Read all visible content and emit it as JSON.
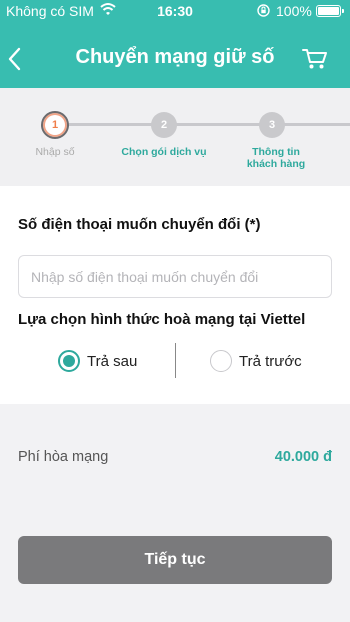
{
  "status_bar": {
    "carrier": "Không có SIM",
    "time": "16:30",
    "battery_percent": "100%"
  },
  "header": {
    "title": "Chuyển mạng giữ số"
  },
  "stepper": {
    "steps": [
      {
        "number": "1",
        "label": "Nhập số",
        "state": "active"
      },
      {
        "number": "2",
        "label": "Chọn gói dịch vụ",
        "state": "pending"
      },
      {
        "number": "3",
        "label": "Thông tin khách hàng",
        "state": "pending"
      }
    ]
  },
  "form": {
    "phone_label": "Số điện thoại muốn chuyển đổi (*)",
    "phone_placeholder": "Nhập số điện thoại muốn chuyển đổi",
    "phone_value": "",
    "subscription_label": "Lựa chọn hình thức hoà mạng tại Viettel",
    "options": [
      {
        "label": "Trả sau",
        "selected": true
      },
      {
        "label": "Trả trước",
        "selected": false
      }
    ]
  },
  "fee": {
    "label": "Phí hòa mạng",
    "value": "40.000 đ"
  },
  "continue_button": {
    "label": "Tiếp tục"
  },
  "colors": {
    "header_bg": "#38bdb0",
    "accent": "#2ea99d",
    "button_disabled": "#7a7a7c",
    "active_step_number": "#f07e4a"
  }
}
